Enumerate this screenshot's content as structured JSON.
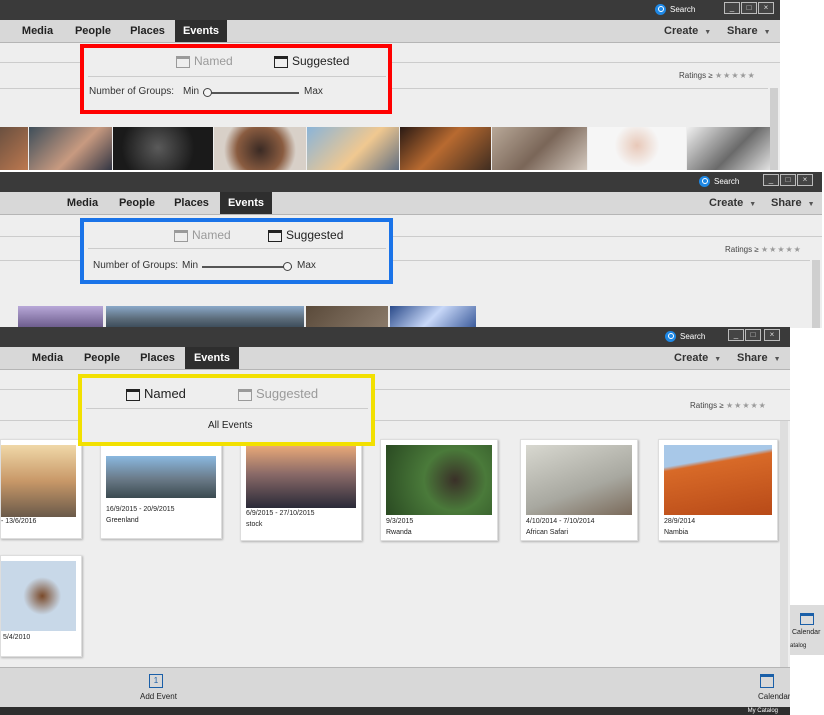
{
  "window1": {
    "search": "Search",
    "tabs": [
      "Media",
      "People",
      "Places",
      "Events"
    ],
    "menus": [
      "Create",
      "Share"
    ],
    "ratings_label": "Ratings",
    "ratings_op": "≥",
    "segment": {
      "named": "Named",
      "suggested": "Suggested",
      "active": "suggested"
    },
    "slider": {
      "label": "Number of Groups:",
      "min": "Min",
      "max": "Max",
      "value": 0.0
    },
    "highlight_color": "#ff0000"
  },
  "window2": {
    "search": "Search",
    "tabs": [
      "Media",
      "People",
      "Places",
      "Events"
    ],
    "menus": [
      "Create",
      "Share"
    ],
    "ratings_label": "Ratings",
    "ratings_op": "≥",
    "segment": {
      "named": "Named",
      "suggested": "Suggested",
      "active": "suggested"
    },
    "slider": {
      "label": "Number of Groups:",
      "min": "Min",
      "max": "Max",
      "value": 1.0
    },
    "highlight_color": "#1a73e8"
  },
  "window3": {
    "search": "Search",
    "tabs": [
      "Media",
      "People",
      "Places",
      "Events"
    ],
    "menus": [
      "Create",
      "Share"
    ],
    "ratings_label": "Ratings",
    "ratings_op": "≥",
    "segment": {
      "named": "Named",
      "suggested": "Suggested",
      "active": "named"
    },
    "all_events": "All Events",
    "highlight_color": "#f2e000",
    "events": [
      {
        "date": "- 13/6/2016",
        "name": ""
      },
      {
        "date": "16/9/2015 - 20/9/2015",
        "name": "Greenland"
      },
      {
        "date": "6/9/2015 - 27/10/2015",
        "name": "stock"
      },
      {
        "date": "9/3/2015",
        "name": "Rwanda"
      },
      {
        "date": "4/10/2014 - 7/10/2014",
        "name": "African Safari"
      },
      {
        "date": "28/9/2014",
        "name": "Nambia"
      },
      {
        "date": "5/4/2010",
        "name": ""
      }
    ],
    "add_event": "Add Event",
    "calendar": "Calendar",
    "catalog": "My Catalog"
  },
  "side_calendar": "Calendar",
  "side_catalog": "atalog"
}
